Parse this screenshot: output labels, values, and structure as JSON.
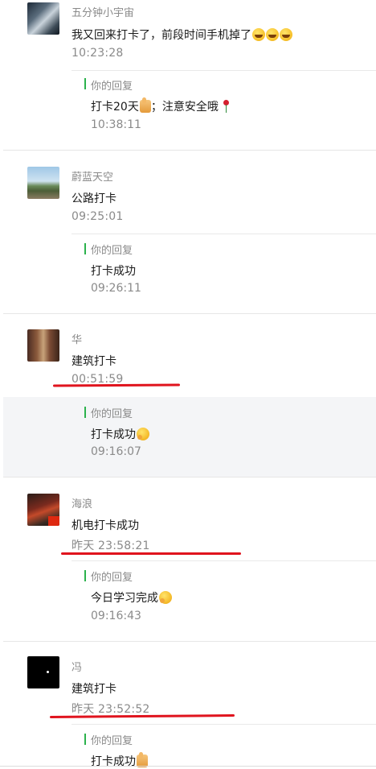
{
  "messages": [
    {
      "name": "五分钟小宇宙",
      "text": "我又回来打卡了，前段时间手机掉了",
      "text_emojis": [
        "grin-icon",
        "grin-icon",
        "grin-icon"
      ],
      "time": "10:23:28",
      "reply_label": "你的回复",
      "reply_text_a": "打卡20天",
      "reply_text_b": "；注意安全哦",
      "reply_emojis": [
        "thumbs-up-icon",
        "rose-icon"
      ],
      "reply_time": "10:38:11"
    },
    {
      "name": "蔚蓝天空",
      "text": "公路打卡",
      "time": "09:25:01",
      "reply_label": "你的回复",
      "reply_text": "打卡成功",
      "reply_time": "09:26:11"
    },
    {
      "name": "华",
      "text": "建筑打卡",
      "time": "00:51:59",
      "reply_label": "你的回复",
      "reply_text": "打卡成功",
      "reply_emojis": [
        "hug-icon"
      ],
      "reply_time": "09:16:07"
    },
    {
      "name": "海浪",
      "text": "机电打卡成功",
      "time": "昨天 23:58:21",
      "reply_label": "你的回复",
      "reply_text": "今日学习完成",
      "reply_emojis": [
        "hug-icon"
      ],
      "reply_time": "09:16:43"
    },
    {
      "name": "冯",
      "text": "建筑打卡",
      "time": "昨天 23:52:52",
      "reply_label": "你的回复",
      "reply_text": "打卡成功",
      "reply_emojis": [
        "thumbs-up-icon"
      ]
    }
  ],
  "colors": {
    "accent_reply_bar": "#2bb24c",
    "annotation_underline": "#e0141e",
    "muted_text": "#8a8a8a"
  }
}
